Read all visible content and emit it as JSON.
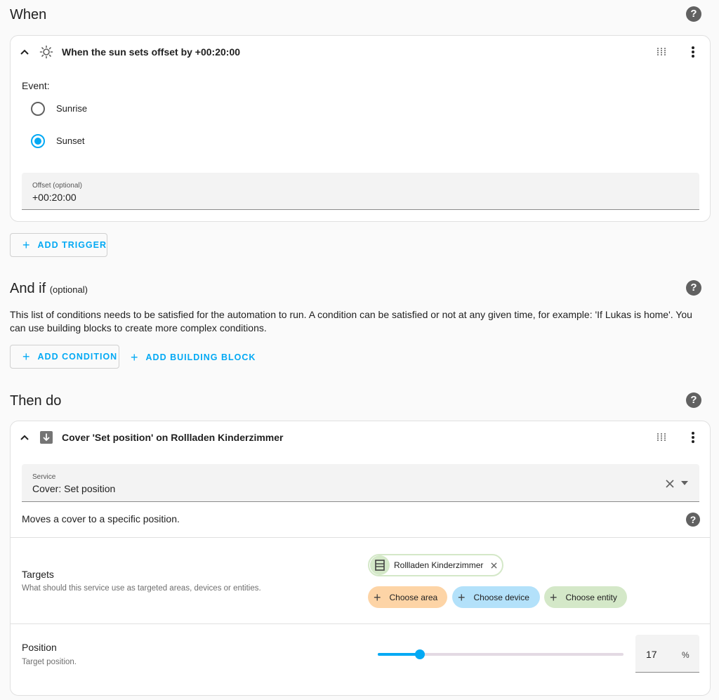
{
  "when": {
    "title": "When",
    "trigger": {
      "title": "When the sun sets offset by +00:20:00",
      "event_label": "Event:",
      "options": [
        "Sunrise",
        "Sunset"
      ],
      "selected": "Sunset",
      "offset_label": "Offset (optional)",
      "offset_value": "+00:20:00"
    },
    "add_trigger_label": "ADD TRIGGER"
  },
  "andif": {
    "title": "And if",
    "optional": "(optional)",
    "description": "This list of conditions needs to be satisfied for the automation to run. A condition can be satisfied or not at any given time, for example: 'If Lukas is home'. You can use building blocks to create more complex conditions.",
    "add_condition_label": "ADD CONDITION",
    "add_building_block_label": "ADD BUILDING BLOCK"
  },
  "thendo": {
    "title": "Then do",
    "action": {
      "title": "Cover 'Set position' on Rollladen Kinderzimmer",
      "service_label": "Service",
      "service_value": "Cover: Set position",
      "service_description": "Moves a cover to a specific position.",
      "targets_title": "Targets",
      "targets_desc": "What should this service use as targeted areas, devices or entities.",
      "entity_chip": "Rollladen Kinderzimmer",
      "choose_area": "Choose area",
      "choose_device": "Choose device",
      "choose_entity": "Choose entity",
      "position_title": "Position",
      "position_desc": "Target position.",
      "position_value": "17",
      "position_unit": "%",
      "position_fraction": 0.17
    }
  },
  "colors": {
    "accent": "#03a9f4",
    "area_chip": "#fdd4a6",
    "device_chip": "#b3e1fa",
    "entity_chip": "#d4e8c8"
  }
}
